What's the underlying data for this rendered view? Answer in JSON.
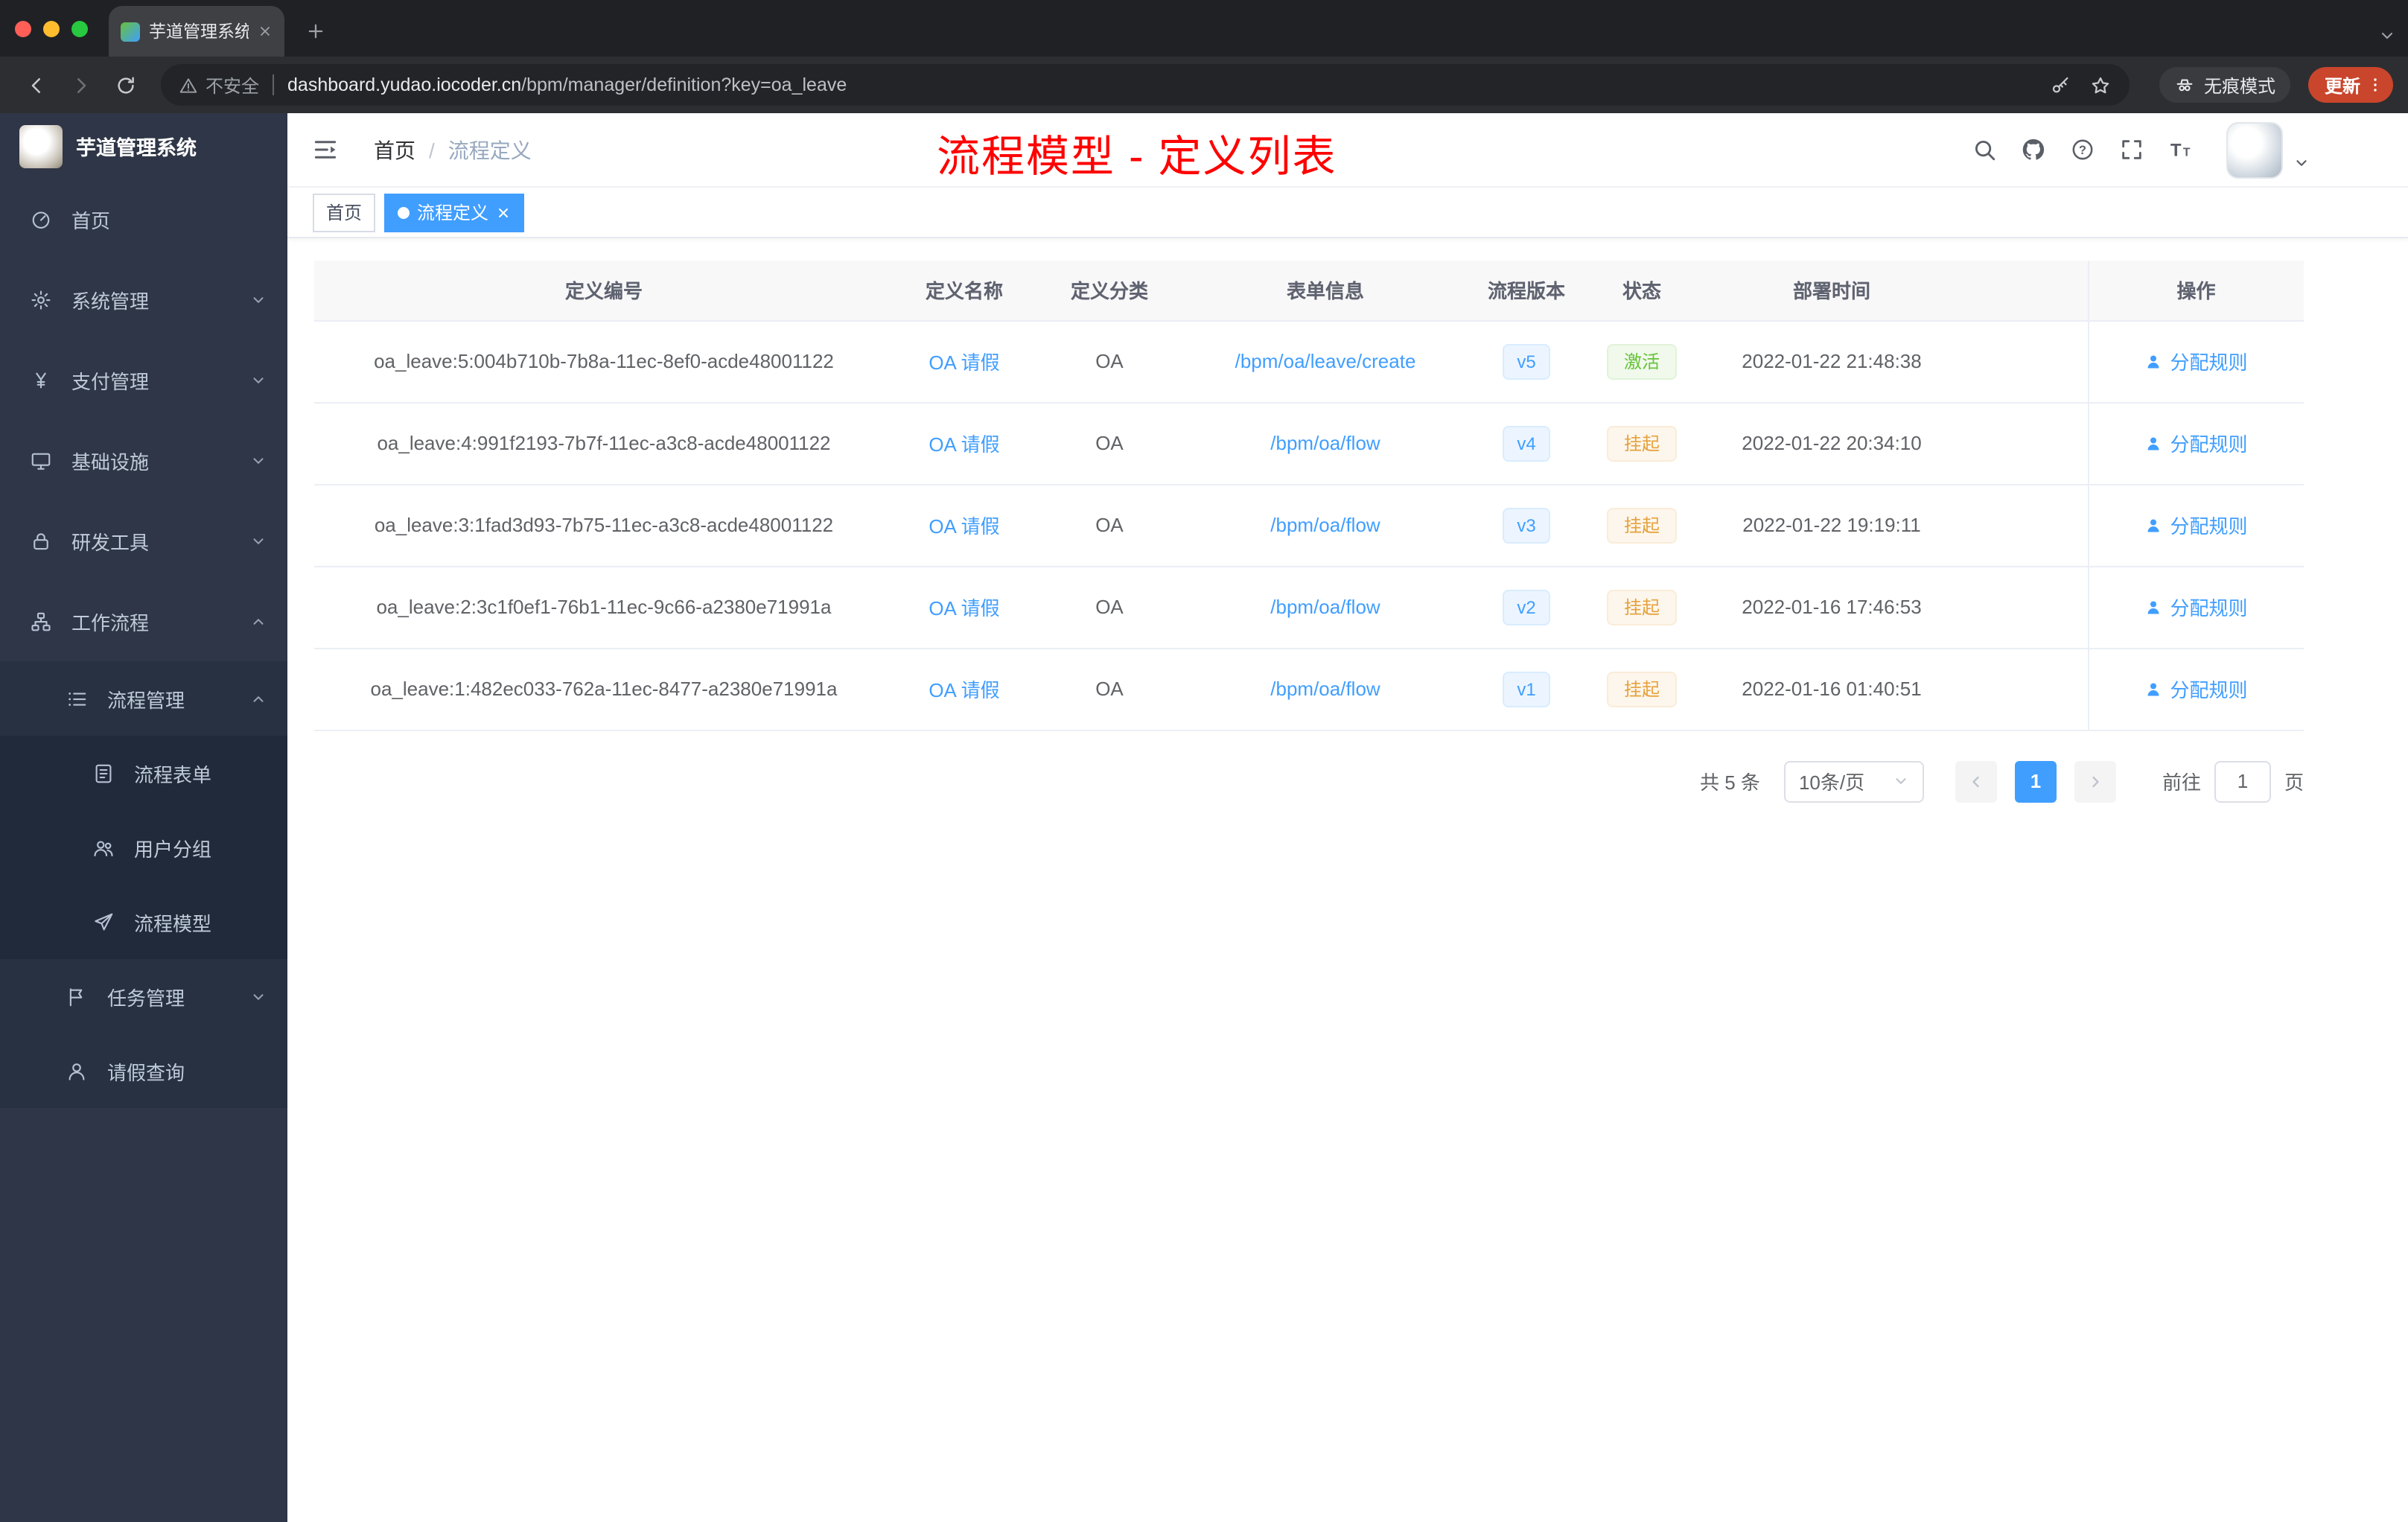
{
  "browser": {
    "tab_title": "芋道管理系统",
    "security_label": "不安全",
    "url_domain": "dashboard.yudao.iocoder.cn",
    "url_path": "/bpm/manager/definition?key=oa_leave",
    "incognito_label": "无痕模式",
    "update_label": "更新"
  },
  "sidebar": {
    "logo_title": "芋道管理系统",
    "items": [
      {
        "label": "首页"
      },
      {
        "label": "系统管理"
      },
      {
        "label": "支付管理"
      },
      {
        "label": "基础设施"
      },
      {
        "label": "研发工具"
      },
      {
        "label": "工作流程"
      },
      {
        "label": "流程管理"
      },
      {
        "label": "流程表单"
      },
      {
        "label": "用户分组"
      },
      {
        "label": "流程模型"
      },
      {
        "label": "任务管理"
      },
      {
        "label": "请假查询"
      }
    ]
  },
  "header": {
    "breadcrumb_home": "首页",
    "breadcrumb_current": "流程定义",
    "annotation": "流程模型 - 定义列表"
  },
  "tags": {
    "home": "首页",
    "active": "流程定义"
  },
  "table": {
    "columns": [
      "定义编号",
      "定义名称",
      "定义分类",
      "表单信息",
      "流程版本",
      "状态",
      "部署时间",
      "操作"
    ],
    "action_label": "分配规则",
    "rows": [
      {
        "id": "oa_leave:5:004b710b-7b8a-11ec-8ef0-acde48001122",
        "name": "OA 请假",
        "category": "OA",
        "form": "/bpm/oa/leave/create",
        "version": "v5",
        "status": "激活",
        "time": "2022-01-22 21:48:38"
      },
      {
        "id": "oa_leave:4:991f2193-7b7f-11ec-a3c8-acde48001122",
        "name": "OA 请假",
        "category": "OA",
        "form": "/bpm/oa/flow",
        "version": "v4",
        "status": "挂起",
        "time": "2022-01-22 20:34:10"
      },
      {
        "id": "oa_leave:3:1fad3d93-7b75-11ec-a3c8-acde48001122",
        "name": "OA 请假",
        "category": "OA",
        "form": "/bpm/oa/flow",
        "version": "v3",
        "status": "挂起",
        "time": "2022-01-22 19:19:11"
      },
      {
        "id": "oa_leave:2:3c1f0ef1-76b1-11ec-9c66-a2380e71991a",
        "name": "OA 请假",
        "category": "OA",
        "form": "/bpm/oa/flow",
        "version": "v2",
        "status": "挂起",
        "time": "2022-01-16 17:46:53"
      },
      {
        "id": "oa_leave:1:482ec033-762a-11ec-8477-a2380e71991a",
        "name": "OA 请假",
        "category": "OA",
        "form": "/bpm/oa/flow",
        "version": "v1",
        "status": "挂起",
        "time": "2022-01-16 01:40:51"
      }
    ]
  },
  "pagination": {
    "total": "共 5 条",
    "page_size": "10条/页",
    "current_page": "1",
    "goto_label": "前往",
    "goto_value": "1",
    "page_unit": "页"
  },
  "colors": {
    "accent": "#409eff",
    "success": "#67c23a",
    "warning": "#e6a23c",
    "annotation_red": "#fe0000",
    "sidebar_bg": "#2f3647"
  },
  "icons": [
    "back-icon",
    "forward-icon",
    "reload-icon",
    "warning-icon",
    "key-icon",
    "star-icon",
    "incognito-icon",
    "kebab-icon",
    "hamburger-icon",
    "search-icon",
    "github-icon",
    "help-icon",
    "fullscreen-icon",
    "font-size-icon",
    "caret-down-icon",
    "user-icon"
  ]
}
